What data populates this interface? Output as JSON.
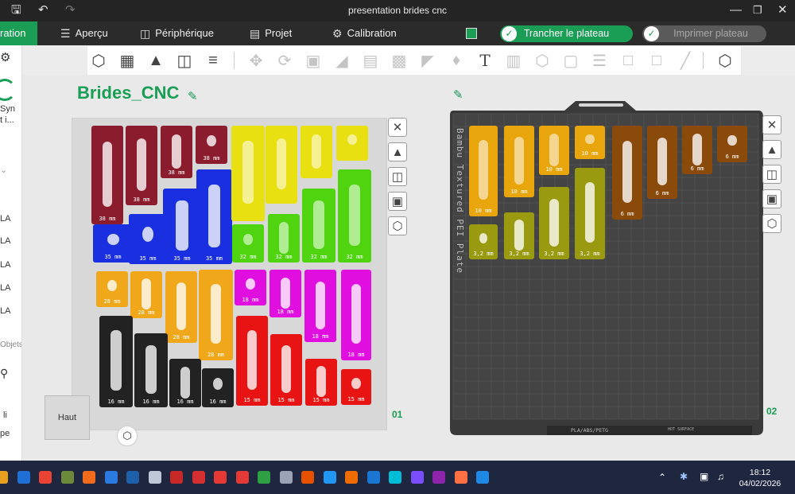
{
  "window": {
    "title": "presentation brides cnc",
    "save_icon": "save-icon",
    "undo_icon": "undo-icon",
    "redo_icon": "redo-icon"
  },
  "menu": {
    "active_tab": "ration",
    "tabs": [
      {
        "label": "Aperçu",
        "icon": "layers-icon"
      },
      {
        "label": "Périphérique",
        "icon": "device-icon"
      },
      {
        "label": "Projet",
        "icon": "document-icon"
      },
      {
        "label": "Calibration",
        "icon": "gear-icon"
      }
    ],
    "slice_button": "Trancher le plateau",
    "print_button": "Imprimer plateau"
  },
  "sidebar": {
    "labels": [
      "Syn",
      "t i...",
      "LA",
      "LA",
      "LA",
      "LA",
      "LA",
      "Objets",
      "li",
      "pe"
    ]
  },
  "plates": {
    "plate1": {
      "name": "Brides_CNC",
      "number": "01"
    },
    "plate2": {
      "number": "02",
      "texture_text": "Bambu Textured PEI Plate",
      "footer_text": "PLA/ABS/PETG",
      "hot_surface": "HOT SURFACE"
    }
  },
  "parts_plate1": [
    {
      "label": "38 mm",
      "color": "#8b1c2e"
    },
    {
      "label": "38 mm",
      "color": "#8b1c2e"
    },
    {
      "label": "38 mm",
      "color": "#8b1c2e"
    },
    {
      "label": "38 mm",
      "color": "#8b1c2e"
    },
    {
      "label": "35 mm",
      "color": "#1a2fe0"
    },
    {
      "label": "35 mm",
      "color": "#1a2fe0"
    },
    {
      "label": "35 mm",
      "color": "#1a2fe0"
    },
    {
      "label": "35 mm",
      "color": "#1a2fe0"
    },
    {
      "label": "",
      "color": "#e8e010"
    },
    {
      "label": "",
      "color": "#e8e010"
    },
    {
      "label": "",
      "color": "#e8e010"
    },
    {
      "label": "",
      "color": "#e8e010"
    },
    {
      "label": "32 mm",
      "color": "#4fd40f"
    },
    {
      "label": "32 mm",
      "color": "#4fd40f"
    },
    {
      "label": "32 mm",
      "color": "#4fd40f"
    },
    {
      "label": "32 mm",
      "color": "#4fd40f"
    },
    {
      "label": "28 mm",
      "color": "#f0a81a"
    },
    {
      "label": "28 mm",
      "color": "#f0a81a"
    },
    {
      "label": "28 mm",
      "color": "#f0a81a"
    },
    {
      "label": "28 mm",
      "color": "#f0a81a"
    },
    {
      "label": "18 mm",
      "color": "#e00fe0"
    },
    {
      "label": "18 mm",
      "color": "#e00fe0"
    },
    {
      "label": "18 mm",
      "color": "#e00fe0"
    },
    {
      "label": "18 mm",
      "color": "#e00fe0"
    },
    {
      "label": "16 mm",
      "color": "#222222"
    },
    {
      "label": "16 mm",
      "color": "#222222"
    },
    {
      "label": "16 mm",
      "color": "#222222"
    },
    {
      "label": "16 mm",
      "color": "#222222"
    },
    {
      "label": "15 mm",
      "color": "#e81414"
    },
    {
      "label": "15 mm",
      "color": "#e81414"
    },
    {
      "label": "15 mm",
      "color": "#e81414"
    },
    {
      "label": "15 mm",
      "color": "#e81414"
    }
  ],
  "parts_plate2": [
    {
      "label": "10 mm",
      "color": "#e8a50c"
    },
    {
      "label": "10 mm",
      "color": "#e8a50c"
    },
    {
      "label": "10 mm",
      "color": "#e8a50c"
    },
    {
      "label": "10 mm",
      "color": "#e8a50c"
    },
    {
      "label": "6 mm",
      "color": "#8a4a0a"
    },
    {
      "label": "6 mm",
      "color": "#8a4a0a"
    },
    {
      "label": "6 mm",
      "color": "#8a4a0a"
    },
    {
      "label": "6 mm",
      "color": "#8a4a0a"
    },
    {
      "label": "3,2 mm",
      "color": "#9a9a10"
    },
    {
      "label": "3,2 mm",
      "color": "#9a9a10"
    },
    {
      "label": "3,2 mm",
      "color": "#9a9a10"
    },
    {
      "label": "3,2 mm",
      "color": "#9a9a10"
    }
  ],
  "view_cube": {
    "label": "Haut"
  },
  "taskbar": {
    "time": "18:12",
    "date": "04/02/2026"
  },
  "colors": {
    "accent": "#1a9e55",
    "plate_dark": "#3a3a3a"
  }
}
